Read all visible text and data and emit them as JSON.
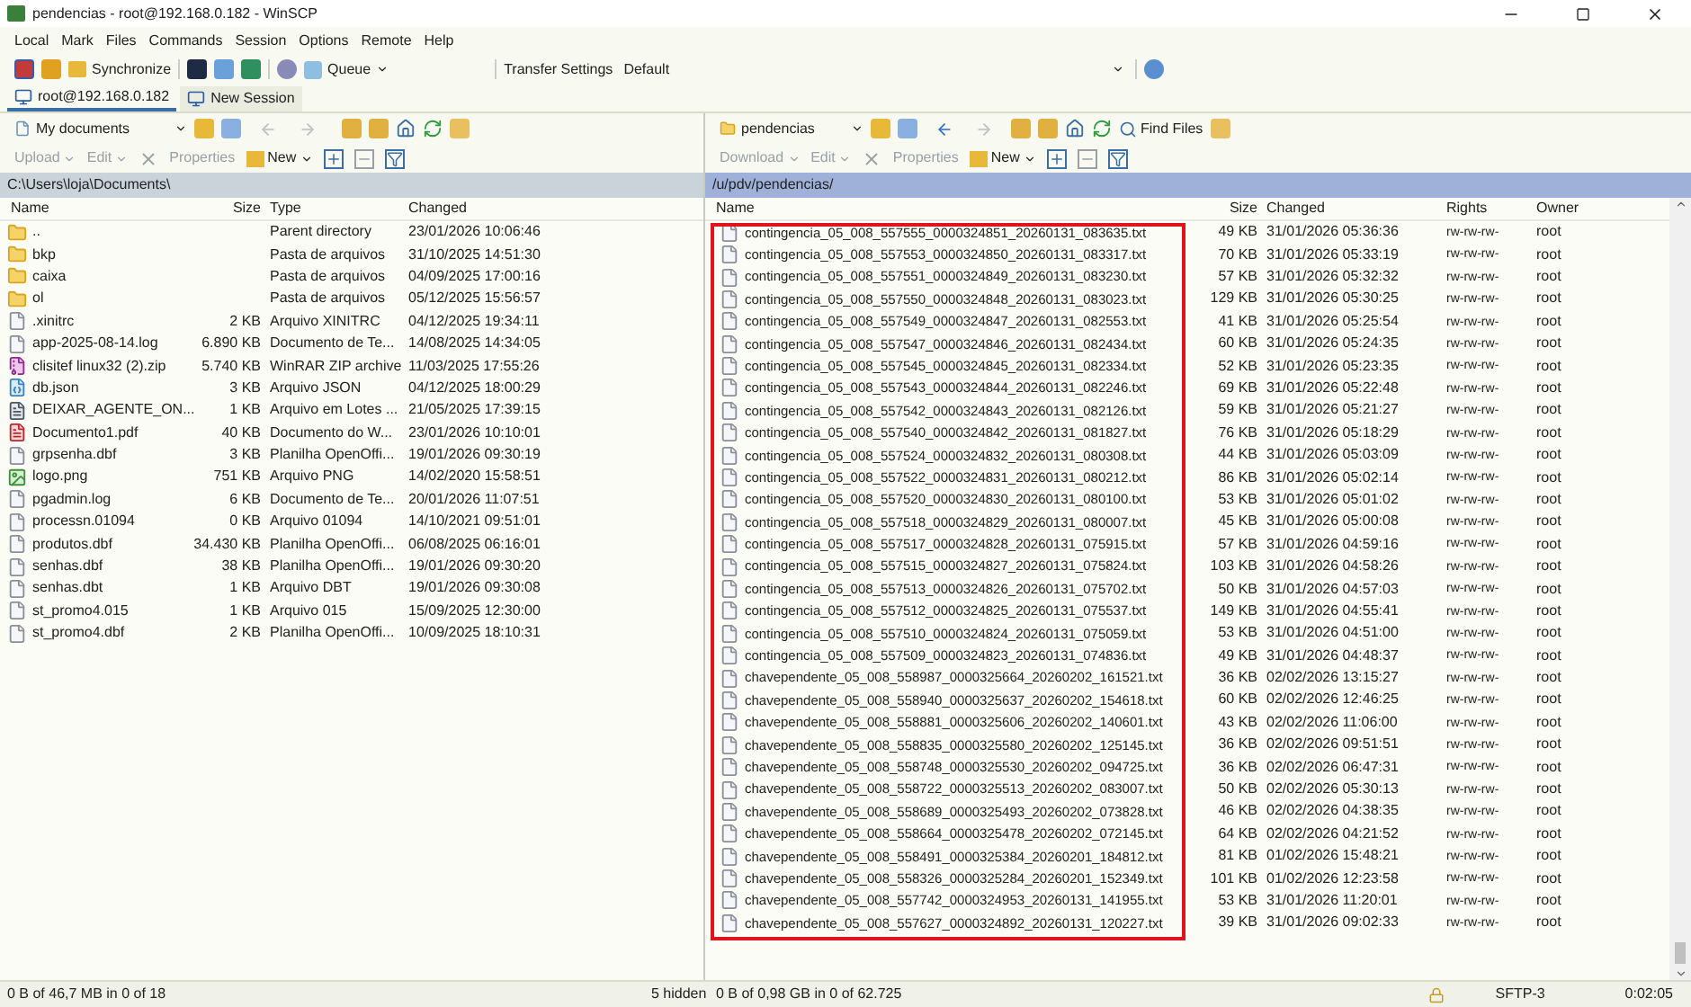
{
  "window": {
    "title": "pendencias - root@192.168.0.182 - WinSCP"
  },
  "menu": [
    "Local",
    "Mark",
    "Files",
    "Commands",
    "Session",
    "Options",
    "Remote",
    "Help"
  ],
  "toolbar": {
    "synchronize": "Synchronize",
    "queue": "Queue",
    "transfer_label": "Transfer Settings",
    "transfer_value": "Default"
  },
  "session_tabs": [
    {
      "label": "root@192.168.0.182",
      "selected": true
    },
    {
      "label": "New Session",
      "selected": false
    }
  ],
  "local": {
    "location": "My documents",
    "actions": {
      "upload": "Upload",
      "edit": "Edit",
      "properties": "Properties",
      "new": "New"
    },
    "path": "C:\\Users\\loja\\Documents\\",
    "columns": [
      "Name",
      "Size",
      "Type",
      "Changed"
    ],
    "rows": [
      {
        "kind": "parent",
        "name": "..",
        "size": "",
        "type": "Parent directory",
        "changed": "23/01/2026 10:06:46"
      },
      {
        "kind": "folder",
        "name": "bkp",
        "size": "",
        "type": "Pasta de arquivos",
        "changed": "31/10/2025 14:51:30"
      },
      {
        "kind": "folder",
        "name": "caixa",
        "size": "",
        "type": "Pasta de arquivos",
        "changed": "04/09/2025 17:00:16"
      },
      {
        "kind": "folder",
        "name": "ol",
        "size": "",
        "type": "Pasta de arquivos",
        "changed": "05/12/2025 15:56:57"
      },
      {
        "kind": "file",
        "name": ".xinitrc",
        "size": "2 KB",
        "type": "Arquivo XINITRC",
        "changed": "04/12/2025 19:34:11"
      },
      {
        "kind": "file",
        "name": "app-2025-08-14.log",
        "size": "6.890 KB",
        "type": "Documento de Te...",
        "changed": "14/08/2025 14:34:05"
      },
      {
        "kind": "zip",
        "name": "clisitef linux32 (2).zip",
        "size": "5.740 KB",
        "type": "WinRAR ZIP archive",
        "changed": "11/03/2025 17:55:26"
      },
      {
        "kind": "json",
        "name": "db.json",
        "size": "3 KB",
        "type": "Arquivo JSON",
        "changed": "04/12/2025 18:00:29"
      },
      {
        "kind": "batch",
        "name": "DEIXAR_AGENTE_ON...",
        "size": "1 KB",
        "type": "Arquivo em Lotes ...",
        "changed": "21/05/2025 17:39:15"
      },
      {
        "kind": "pdf",
        "name": "Documento1.pdf",
        "size": "40 KB",
        "type": "Documento do W...",
        "changed": "23/01/2026 10:10:01"
      },
      {
        "kind": "file",
        "name": "grpsenha.dbf",
        "size": "3 KB",
        "type": "Planilha OpenOffi...",
        "changed": "19/01/2026 09:30:19"
      },
      {
        "kind": "image",
        "name": "logo.png",
        "size": "751 KB",
        "type": "Arquivo PNG",
        "changed": "14/02/2020 15:58:51"
      },
      {
        "kind": "file",
        "name": "pgadmin.log",
        "size": "6 KB",
        "type": "Documento de Te...",
        "changed": "20/01/2026 11:07:51"
      },
      {
        "kind": "file",
        "name": "processn.01094",
        "size": "0 KB",
        "type": "Arquivo 01094",
        "changed": "14/10/2021 09:51:01"
      },
      {
        "kind": "file",
        "name": "produtos.dbf",
        "size": "34.430 KB",
        "type": "Planilha OpenOffi...",
        "changed": "06/08/2025 06:16:01"
      },
      {
        "kind": "file",
        "name": "senhas.dbf",
        "size": "38 KB",
        "type": "Planilha OpenOffi...",
        "changed": "19/01/2026 09:30:20"
      },
      {
        "kind": "file",
        "name": "senhas.dbt",
        "size": "1 KB",
        "type": "Arquivo DBT",
        "changed": "19/01/2026 09:30:08"
      },
      {
        "kind": "file",
        "name": "st_promo4.015",
        "size": "1 KB",
        "type": "Arquivo 015",
        "changed": "15/09/2025 12:30:00"
      },
      {
        "kind": "file",
        "name": "st_promo4.dbf",
        "size": "2 KB",
        "type": "Planilha OpenOffi...",
        "changed": "10/09/2025 18:10:31"
      }
    ]
  },
  "remote": {
    "location": "pendencias",
    "actions": {
      "download": "Download",
      "edit": "Edit",
      "properties": "Properties",
      "new": "New",
      "find": "Find Files"
    },
    "path": "/u/pdv/pendencias/",
    "columns": [
      "Name",
      "Size",
      "Changed",
      "Rights",
      "Owner"
    ],
    "rows": [
      {
        "name": "contingencia_05_008_557555_0000324851_20260131_083635.txt",
        "size": "49 KB",
        "changed": "31/01/2026 05:36:36",
        "rights": "rw-rw-rw-",
        "owner": "root"
      },
      {
        "name": "contingencia_05_008_557553_0000324850_20260131_083317.txt",
        "size": "70 KB",
        "changed": "31/01/2026 05:33:19",
        "rights": "rw-rw-rw-",
        "owner": "root"
      },
      {
        "name": "contingencia_05_008_557551_0000324849_20260131_083230.txt",
        "size": "57 KB",
        "changed": "31/01/2026 05:32:32",
        "rights": "rw-rw-rw-",
        "owner": "root"
      },
      {
        "name": "contingencia_05_008_557550_0000324848_20260131_083023.txt",
        "size": "129 KB",
        "changed": "31/01/2026 05:30:25",
        "rights": "rw-rw-rw-",
        "owner": "root"
      },
      {
        "name": "contingencia_05_008_557549_0000324847_20260131_082553.txt",
        "size": "41 KB",
        "changed": "31/01/2026 05:25:54",
        "rights": "rw-rw-rw-",
        "owner": "root"
      },
      {
        "name": "contingencia_05_008_557547_0000324846_20260131_082434.txt",
        "size": "60 KB",
        "changed": "31/01/2026 05:24:35",
        "rights": "rw-rw-rw-",
        "owner": "root"
      },
      {
        "name": "contingencia_05_008_557545_0000324845_20260131_082334.txt",
        "size": "52 KB",
        "changed": "31/01/2026 05:23:35",
        "rights": "rw-rw-rw-",
        "owner": "root"
      },
      {
        "name": "contingencia_05_008_557543_0000324844_20260131_082246.txt",
        "size": "69 KB",
        "changed": "31/01/2026 05:22:48",
        "rights": "rw-rw-rw-",
        "owner": "root"
      },
      {
        "name": "contingencia_05_008_557542_0000324843_20260131_082126.txt",
        "size": "59 KB",
        "changed": "31/01/2026 05:21:27",
        "rights": "rw-rw-rw-",
        "owner": "root"
      },
      {
        "name": "contingencia_05_008_557540_0000324842_20260131_081827.txt",
        "size": "76 KB",
        "changed": "31/01/2026 05:18:29",
        "rights": "rw-rw-rw-",
        "owner": "root"
      },
      {
        "name": "contingencia_05_008_557524_0000324832_20260131_080308.txt",
        "size": "44 KB",
        "changed": "31/01/2026 05:03:09",
        "rights": "rw-rw-rw-",
        "owner": "root"
      },
      {
        "name": "contingencia_05_008_557522_0000324831_20260131_080212.txt",
        "size": "86 KB",
        "changed": "31/01/2026 05:02:14",
        "rights": "rw-rw-rw-",
        "owner": "root"
      },
      {
        "name": "contingencia_05_008_557520_0000324830_20260131_080100.txt",
        "size": "53 KB",
        "changed": "31/01/2026 05:01:02",
        "rights": "rw-rw-rw-",
        "owner": "root"
      },
      {
        "name": "contingencia_05_008_557518_0000324829_20260131_080007.txt",
        "size": "45 KB",
        "changed": "31/01/2026 05:00:08",
        "rights": "rw-rw-rw-",
        "owner": "root"
      },
      {
        "name": "contingencia_05_008_557517_0000324828_20260131_075915.txt",
        "size": "57 KB",
        "changed": "31/01/2026 04:59:16",
        "rights": "rw-rw-rw-",
        "owner": "root"
      },
      {
        "name": "contingencia_05_008_557515_0000324827_20260131_075824.txt",
        "size": "103 KB",
        "changed": "31/01/2026 04:58:26",
        "rights": "rw-rw-rw-",
        "owner": "root"
      },
      {
        "name": "contingencia_05_008_557513_0000324826_20260131_075702.txt",
        "size": "50 KB",
        "changed": "31/01/2026 04:57:03",
        "rights": "rw-rw-rw-",
        "owner": "root"
      },
      {
        "name": "contingencia_05_008_557512_0000324825_20260131_075537.txt",
        "size": "149 KB",
        "changed": "31/01/2026 04:55:41",
        "rights": "rw-rw-rw-",
        "owner": "root"
      },
      {
        "name": "contingencia_05_008_557510_0000324824_20260131_075059.txt",
        "size": "53 KB",
        "changed": "31/01/2026 04:51:00",
        "rights": "rw-rw-rw-",
        "owner": "root"
      },
      {
        "name": "contingencia_05_008_557509_0000324823_20260131_074836.txt",
        "size": "49 KB",
        "changed": "31/01/2026 04:48:37",
        "rights": "rw-rw-rw-",
        "owner": "root"
      },
      {
        "name": "chavependente_05_008_558987_0000325664_20260202_161521.txt",
        "size": "36 KB",
        "changed": "02/02/2026 13:15:27",
        "rights": "rw-rw-rw-",
        "owner": "root"
      },
      {
        "name": "chavependente_05_008_558940_0000325637_20260202_154618.txt",
        "size": "60 KB",
        "changed": "02/02/2026 12:46:25",
        "rights": "rw-rw-rw-",
        "owner": "root"
      },
      {
        "name": "chavependente_05_008_558881_0000325606_20260202_140601.txt",
        "size": "43 KB",
        "changed": "02/02/2026 11:06:00",
        "rights": "rw-rw-rw-",
        "owner": "root"
      },
      {
        "name": "chavependente_05_008_558835_0000325580_20260202_125145.txt",
        "size": "36 KB",
        "changed": "02/02/2026 09:51:51",
        "rights": "rw-rw-rw-",
        "owner": "root"
      },
      {
        "name": "chavependente_05_008_558748_0000325530_20260202_094725.txt",
        "size": "36 KB",
        "changed": "02/02/2026 06:47:31",
        "rights": "rw-rw-rw-",
        "owner": "root"
      },
      {
        "name": "chavependente_05_008_558722_0000325513_20260202_083007.txt",
        "size": "50 KB",
        "changed": "02/02/2026 05:30:13",
        "rights": "rw-rw-rw-",
        "owner": "root"
      },
      {
        "name": "chavependente_05_008_558689_0000325493_20260202_073828.txt",
        "size": "46 KB",
        "changed": "02/02/2026 04:38:35",
        "rights": "rw-rw-rw-",
        "owner": "root"
      },
      {
        "name": "chavependente_05_008_558664_0000325478_20260202_072145.txt",
        "size": "64 KB",
        "changed": "02/02/2026 04:21:52",
        "rights": "rw-rw-rw-",
        "owner": "root"
      },
      {
        "name": "chavependente_05_008_558491_0000325384_20260201_184812.txt",
        "size": "81 KB",
        "changed": "01/02/2026 15:48:21",
        "rights": "rw-rw-rw-",
        "owner": "root"
      },
      {
        "name": "chavependente_05_008_558326_0000325284_20260201_152349.txt",
        "size": "101 KB",
        "changed": "01/02/2026 12:23:58",
        "rights": "rw-rw-rw-",
        "owner": "root"
      },
      {
        "name": "chavependente_05_008_557742_0000324953_20260131_141955.txt",
        "size": "53 KB",
        "changed": "31/01/2026 11:20:01",
        "rights": "rw-rw-rw-",
        "owner": "root"
      },
      {
        "name": "chavependente_05_008_557627_0000324892_20260131_120227.txt",
        "size": "39 KB",
        "changed": "31/01/2026 09:02:33",
        "rights": "rw-rw-rw-",
        "owner": "root"
      }
    ]
  },
  "status_bar": {
    "local": "0 B of 46,7 MB in 0 of 18",
    "hidden": "5 hidden",
    "remote": "0 B of 0,98 GB in 0 of 62.725",
    "protocol": "SFTP-3",
    "elapsed": "0:02:05"
  }
}
